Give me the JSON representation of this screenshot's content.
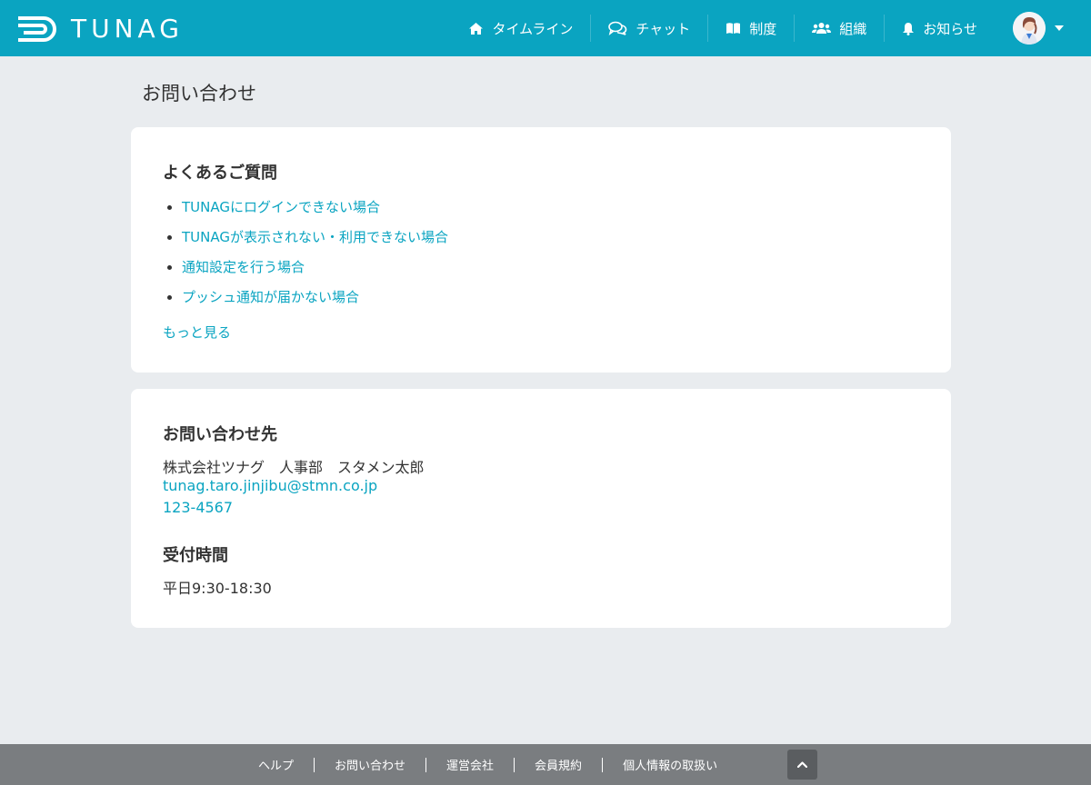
{
  "header": {
    "logo_text": "TUNAG",
    "nav": [
      {
        "label": "タイムライン",
        "icon": "home-icon"
      },
      {
        "label": "チャット",
        "icon": "chat-icon"
      },
      {
        "label": "制度",
        "icon": "book-icon"
      },
      {
        "label": "組織",
        "icon": "users-icon"
      },
      {
        "label": "お知らせ",
        "icon": "bell-icon"
      }
    ],
    "brand_color": "#0aa4c1"
  },
  "page": {
    "title": "お問い合わせ"
  },
  "faq": {
    "title": "よくあるご質問",
    "items": [
      "TUNAGにログインできない場合",
      "TUNAGが表示されない・利用できない場合",
      "通知設定を行う場合",
      "プッシュ通知が届かない場合"
    ],
    "more_label": "もっと見る"
  },
  "contact": {
    "title": "お問い合わせ先",
    "name": "株式会社ツナグ　人事部　スタメン太郎",
    "email": "tunag.taro.jinjibu@stmn.co.jp",
    "phone": "123-4567",
    "hours_title": "受付時間",
    "hours_value": "平日9:30-18:30"
  },
  "footer": {
    "links": [
      "ヘルプ",
      "お問い合わせ",
      "運営会社",
      "会員規約",
      "個人情報の取扱い"
    ]
  }
}
